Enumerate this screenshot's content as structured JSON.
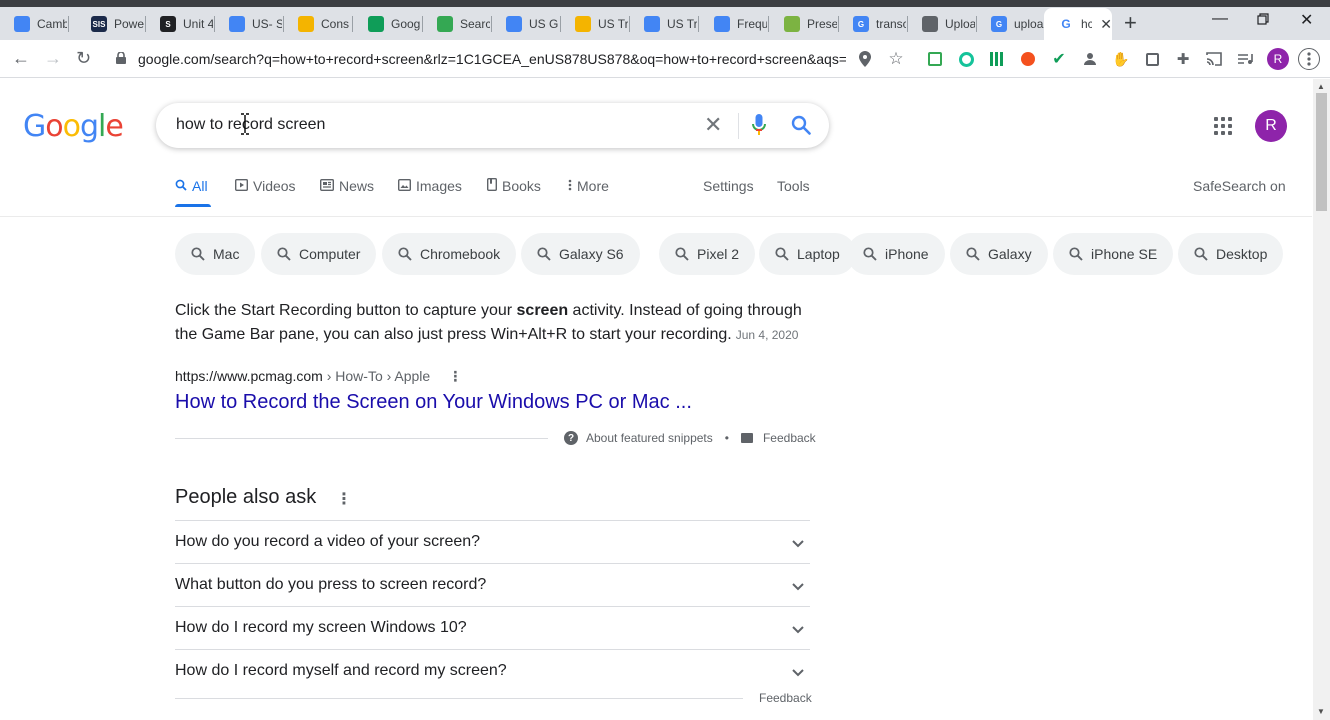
{
  "browser": {
    "tabs": [
      {
        "title": "Camb",
        "color": "#4285f4",
        "glyph": ""
      },
      {
        "title": "Powe",
        "color": "#1b2a4a",
        "glyph": "SIS"
      },
      {
        "title": "Unit 4",
        "color": "#202124",
        "glyph": "S"
      },
      {
        "title": "US- S",
        "color": "#4285f4",
        "glyph": ""
      },
      {
        "title": "Cons",
        "color": "#f4b400",
        "glyph": ""
      },
      {
        "title": "Goog",
        "color": "#0f9d58",
        "glyph": ""
      },
      {
        "title": "Searc",
        "color": "#34a853",
        "glyph": ""
      },
      {
        "title": "US Gu",
        "color": "#4285f4",
        "glyph": ""
      },
      {
        "title": "US Tr",
        "color": "#f4b400",
        "glyph": ""
      },
      {
        "title": "US Tr",
        "color": "#4285f4",
        "glyph": ""
      },
      {
        "title": "Frequ",
        "color": "#4285f4",
        "glyph": ""
      },
      {
        "title": "Prese",
        "color": "#7cb342",
        "glyph": ""
      },
      {
        "title": "transc",
        "color": "#4285f4",
        "glyph": "G"
      },
      {
        "title": "Uploa",
        "color": "#5f6368",
        "glyph": ""
      },
      {
        "title": "uploa",
        "color": "#4285f4",
        "glyph": "G"
      }
    ],
    "active_tab": {
      "title": "hc"
    },
    "new_tab_symbol": "+",
    "url": "google.com/search?q=how+to+record+screen&rlz=1C1GCEA_enUS878US878&oq=how+to+record+screen&aqs=...",
    "profile_initial": "R"
  },
  "google": {
    "logo": "Google",
    "query": "how to record screen",
    "avatar_initial": "R",
    "nav": [
      {
        "label": "All",
        "icon": "search-icon"
      },
      {
        "label": "Videos",
        "icon": "video-icon"
      },
      {
        "label": "News",
        "icon": "news-icon"
      },
      {
        "label": "Images",
        "icon": "image-icon"
      },
      {
        "label": "Books",
        "icon": "book-icon"
      },
      {
        "label": "More",
        "icon": "more-icon"
      },
      {
        "label": "Settings"
      },
      {
        "label": "Tools"
      }
    ],
    "safesearch": "SafeSearch on",
    "chips": [
      "Mac",
      "Computer",
      "Chromebook",
      "Galaxy S6",
      "Pixel 2",
      "Laptop",
      "iPhone",
      "Galaxy",
      "iPhone SE",
      "Desktop"
    ],
    "snippet": {
      "text_before": "Click the Start Recording button to capture your ",
      "bold": "screen",
      "text_after": " activity. Instead of going through the Game Bar pane, you can also just press Win+Alt+R to start your recording.",
      "date": "Jun 4, 2020"
    },
    "result": {
      "cite_host": "https://www.pcmag.com",
      "cite_path": " › How-To › Apple",
      "title": "How to Record the Screen on Your Windows PC or Mac ..."
    },
    "snippet_footer": {
      "about": "About featured snippets",
      "bullet": "•",
      "feedback": "Feedback"
    },
    "people_also_ask": {
      "title": "People also ask",
      "questions": [
        "How do you record a video of your screen?",
        "What button do you press to screen record?",
        "How do I record my screen Windows 10?",
        "How do I record myself and record my screen?"
      ],
      "feedback": "Feedback"
    }
  }
}
